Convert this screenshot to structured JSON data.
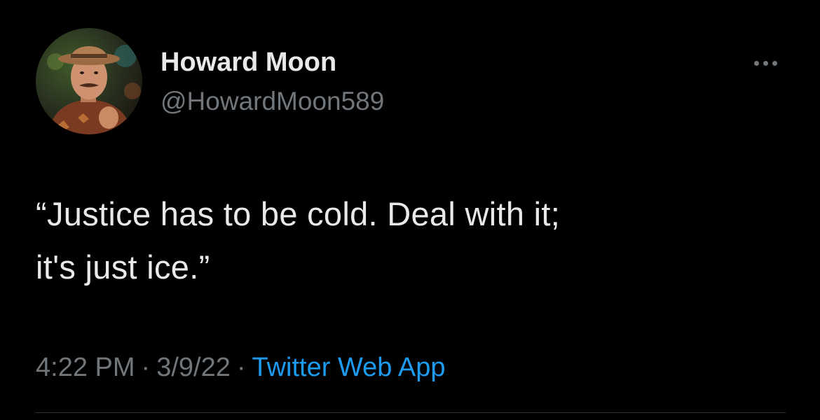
{
  "theme": {
    "background": "#000000",
    "text_primary": "#e7e9ea",
    "text_secondary": "#71767b",
    "link": "#1d9bf0"
  },
  "tweet": {
    "author": {
      "display_name": "Howard Moon",
      "handle": "@HowardMoon589",
      "avatar": "profile-photo"
    },
    "more_icon": "ellipsis-icon",
    "text_line1": "“Justice has to be cold. Deal with it;",
    "text_line2": "it's just ice.”",
    "time": "4:22 PM",
    "separator": "·",
    "date": "3/9/22",
    "source": "Twitter Web App"
  }
}
